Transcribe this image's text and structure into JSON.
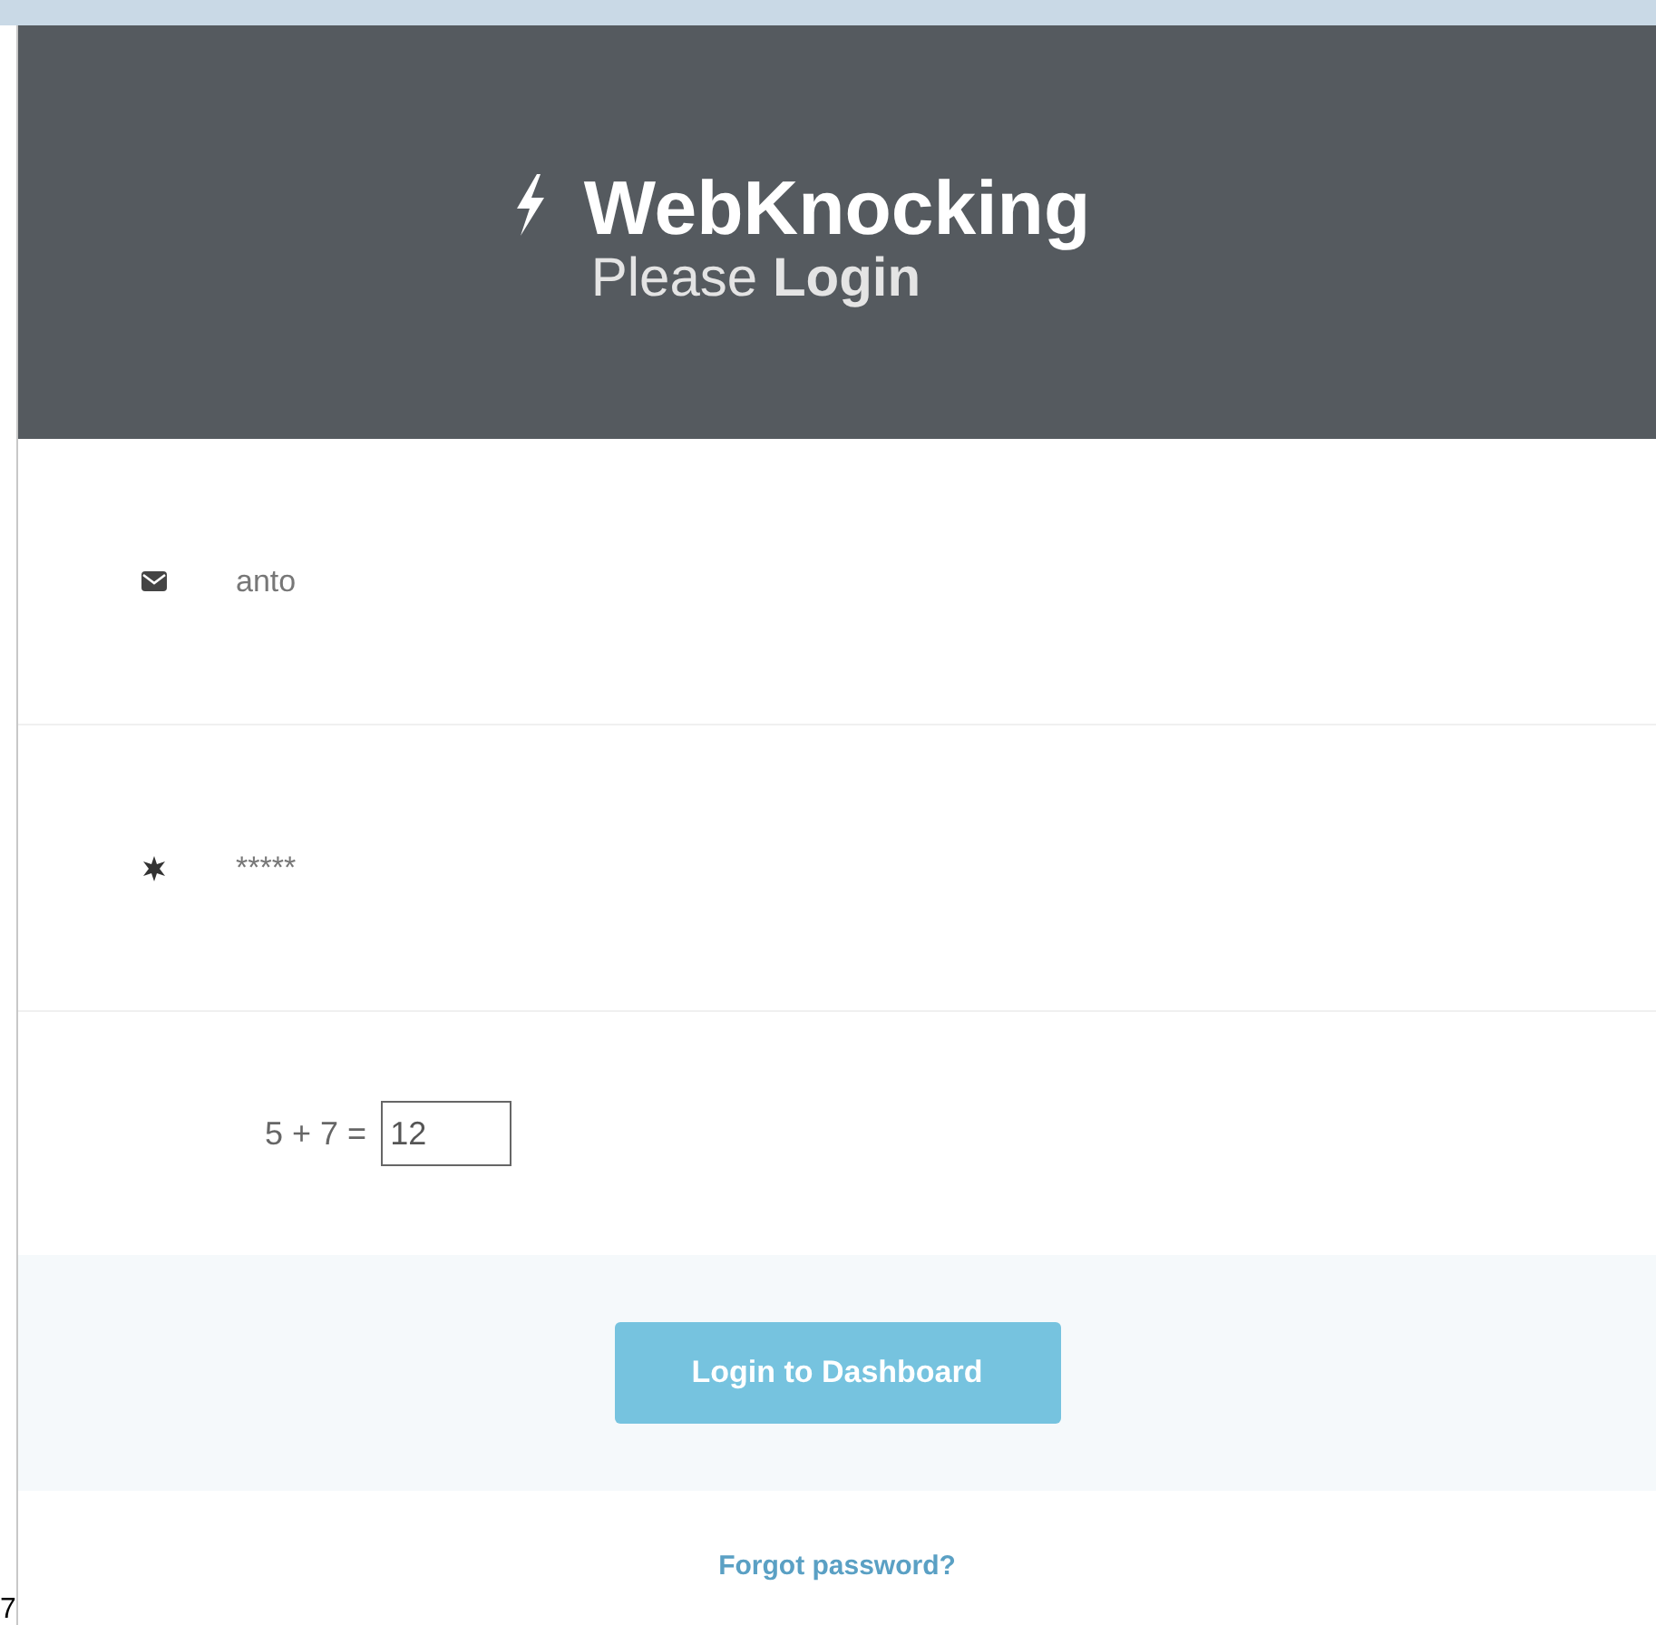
{
  "header": {
    "title": "WebKnocking",
    "subtitle": "Please **Login**"
  },
  "fields": [
    {
      "kind": "text",
      "value": "anto"
    },
    {
      "kind": "password",
      "value": "*****"
    }
  ],
  "captcha": {
    "question": "5 + 7 =",
    "value": "12"
  },
  "button": "Login to Dashboard",
  "link": "Forgot password?",
  "corner_text": "7"
}
